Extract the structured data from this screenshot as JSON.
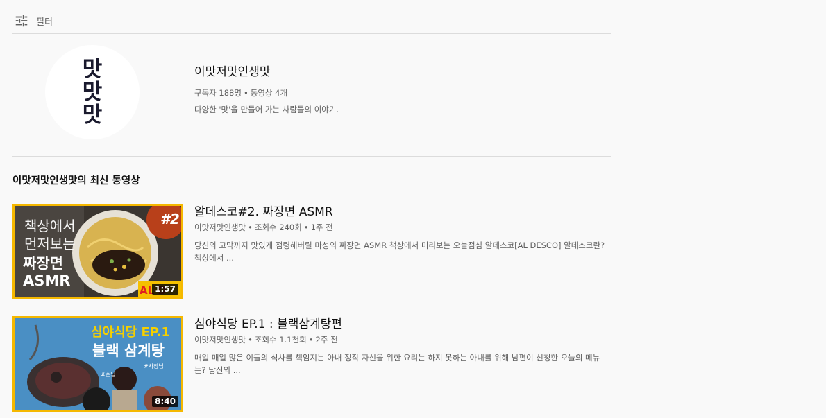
{
  "filter": {
    "label": "필터",
    "icon": "filter-sliders-icon"
  },
  "channel": {
    "avatar_lines": [
      "맛",
      "맛",
      "맛"
    ],
    "name": "이맛저맛인생맛",
    "subscribers": "구독자 188명",
    "video_count": "동영상 4개",
    "description": "다양한 '맛'을 만들어 가는 사람들의 이야기."
  },
  "section": {
    "title": "이맛저맛인생맛의 최신 동영상"
  },
  "videos": [
    {
      "title": "알데스코#2. 짜장면 ASMR",
      "channel": "이맛저맛인생맛",
      "views": "조회수 240회",
      "age": "1주 전",
      "description": "당신의 고막까지 맛있게 점령해버릴 마성의 짜장면 ASMR 책상에서 미리보는 오늘점심 알데스코[AL DESCO] 알데스코란? 책상에서 ...",
      "duration": "1:57",
      "thumb_text": {
        "line1": "책상에서",
        "line2": "먼저보는",
        "line3": "짜장면",
        "line4": "ASMR",
        "badge": "#2",
        "corner": "AL D"
      }
    },
    {
      "title": "심야식당 EP.1 : 블랙삼계탕편",
      "channel": "이맛저맛인생맛",
      "views": "조회수 1.1천회",
      "age": "2주 전",
      "description": "매일 매일 많은 이들의 식사를 책임지는 아내 정작 자신을 위한 요리는 하지 못하는 아내를 위해 남편이 신청한 오늘의 메뉴는? 당신의 ...",
      "duration": "8:40",
      "thumb_text": {
        "line1": "심야식당 EP.1",
        "line2": "블랙 삼계탕",
        "tag1": "#손님",
        "tag2": "#사장님"
      }
    }
  ],
  "colors": {
    "accent_border": "#f5b800",
    "background": "#f9f9f9",
    "secondary_text": "#606060"
  }
}
